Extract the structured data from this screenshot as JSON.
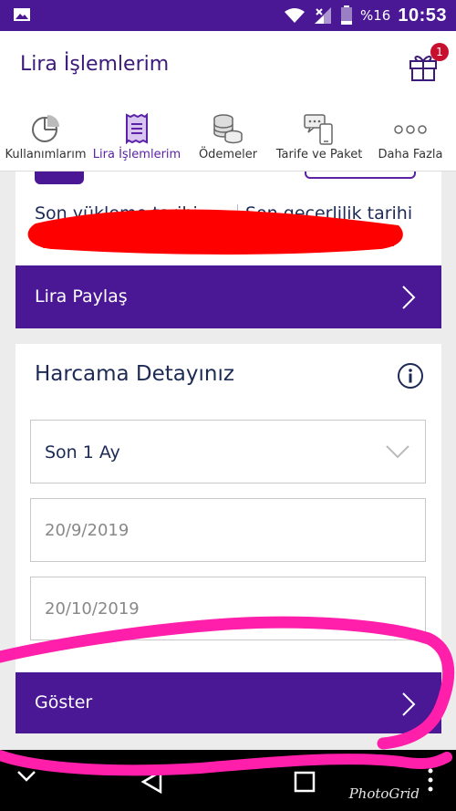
{
  "status_bar": {
    "battery_text": "%16",
    "time": "10:53"
  },
  "header": {
    "title": "Lira İşlemlerim",
    "gift_badge_count": "1"
  },
  "tabs": [
    {
      "label": "Kullanımlarım",
      "icon": "pie-chart-icon",
      "active": false
    },
    {
      "label": "Lira İşlemlerim",
      "icon": "receipt-icon",
      "active": true
    },
    {
      "label": "Ödemeler",
      "icon": "coins-icon",
      "active": false
    },
    {
      "label": "Tarife ve Paket",
      "icon": "phone-chat-icon",
      "active": false
    },
    {
      "label": "Daha Fazla",
      "icon": "more-dots-icon",
      "active": false
    }
  ],
  "balance_card": {
    "last_load_label": "Son yükleme tarihi",
    "validity_label": "Son geçerlilik tarihi"
  },
  "share_button": {
    "label": "Lira Paylaş"
  },
  "spending": {
    "heading": "Harcama Detayınız",
    "period_select": "Son 1 Ay",
    "start_date": "20/9/2019",
    "end_date": "20/10/2019",
    "show_button": "Göster"
  },
  "watermark": "PhotoGrid",
  "colors": {
    "brand_purple": "#4a1795",
    "accent_purple": "#5b22a6",
    "text_navy": "#1d2a55",
    "badge_red": "#c8102e",
    "redaction_red": "#ff0000",
    "marker_pink": "#ff1faa"
  }
}
